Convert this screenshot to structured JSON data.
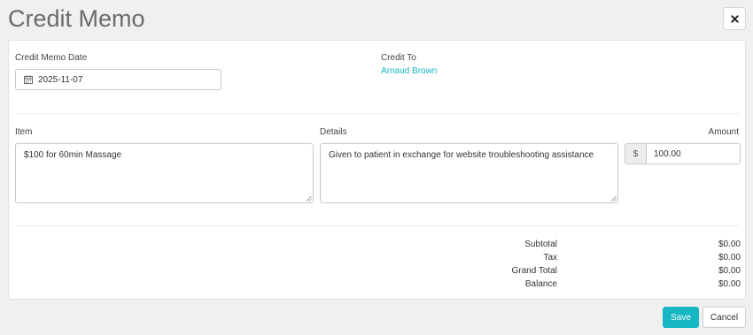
{
  "header": {
    "title": "Credit Memo",
    "close_icon": "close-icon"
  },
  "form": {
    "date_label": "Credit Memo Date",
    "date_value": "2025-11-07",
    "date_icon": "calendar-icon",
    "credit_to_label": "Credit To",
    "credit_to_name": "Arnaud Brown"
  },
  "line_item": {
    "item_label": "Item",
    "item_value": "$100 for 60min Massage",
    "details_label": "Details",
    "details_value": "Given to patient in exchange for website troubleshooting assistance",
    "amount_label": "Amount",
    "amount_prefix": "$",
    "amount_value": "100.00"
  },
  "totals": [
    {
      "label": "Subtotal",
      "value": "$0.00"
    },
    {
      "label": "Tax",
      "value": "$0.00"
    },
    {
      "label": "Grand Total",
      "value": "$0.00"
    },
    {
      "label": "Balance",
      "value": "$0.00"
    }
  ],
  "footer": {
    "save_label": "Save",
    "cancel_label": "Cancel"
  },
  "colors": {
    "accent": "#17b6c4",
    "background": "#f0f0f0"
  }
}
